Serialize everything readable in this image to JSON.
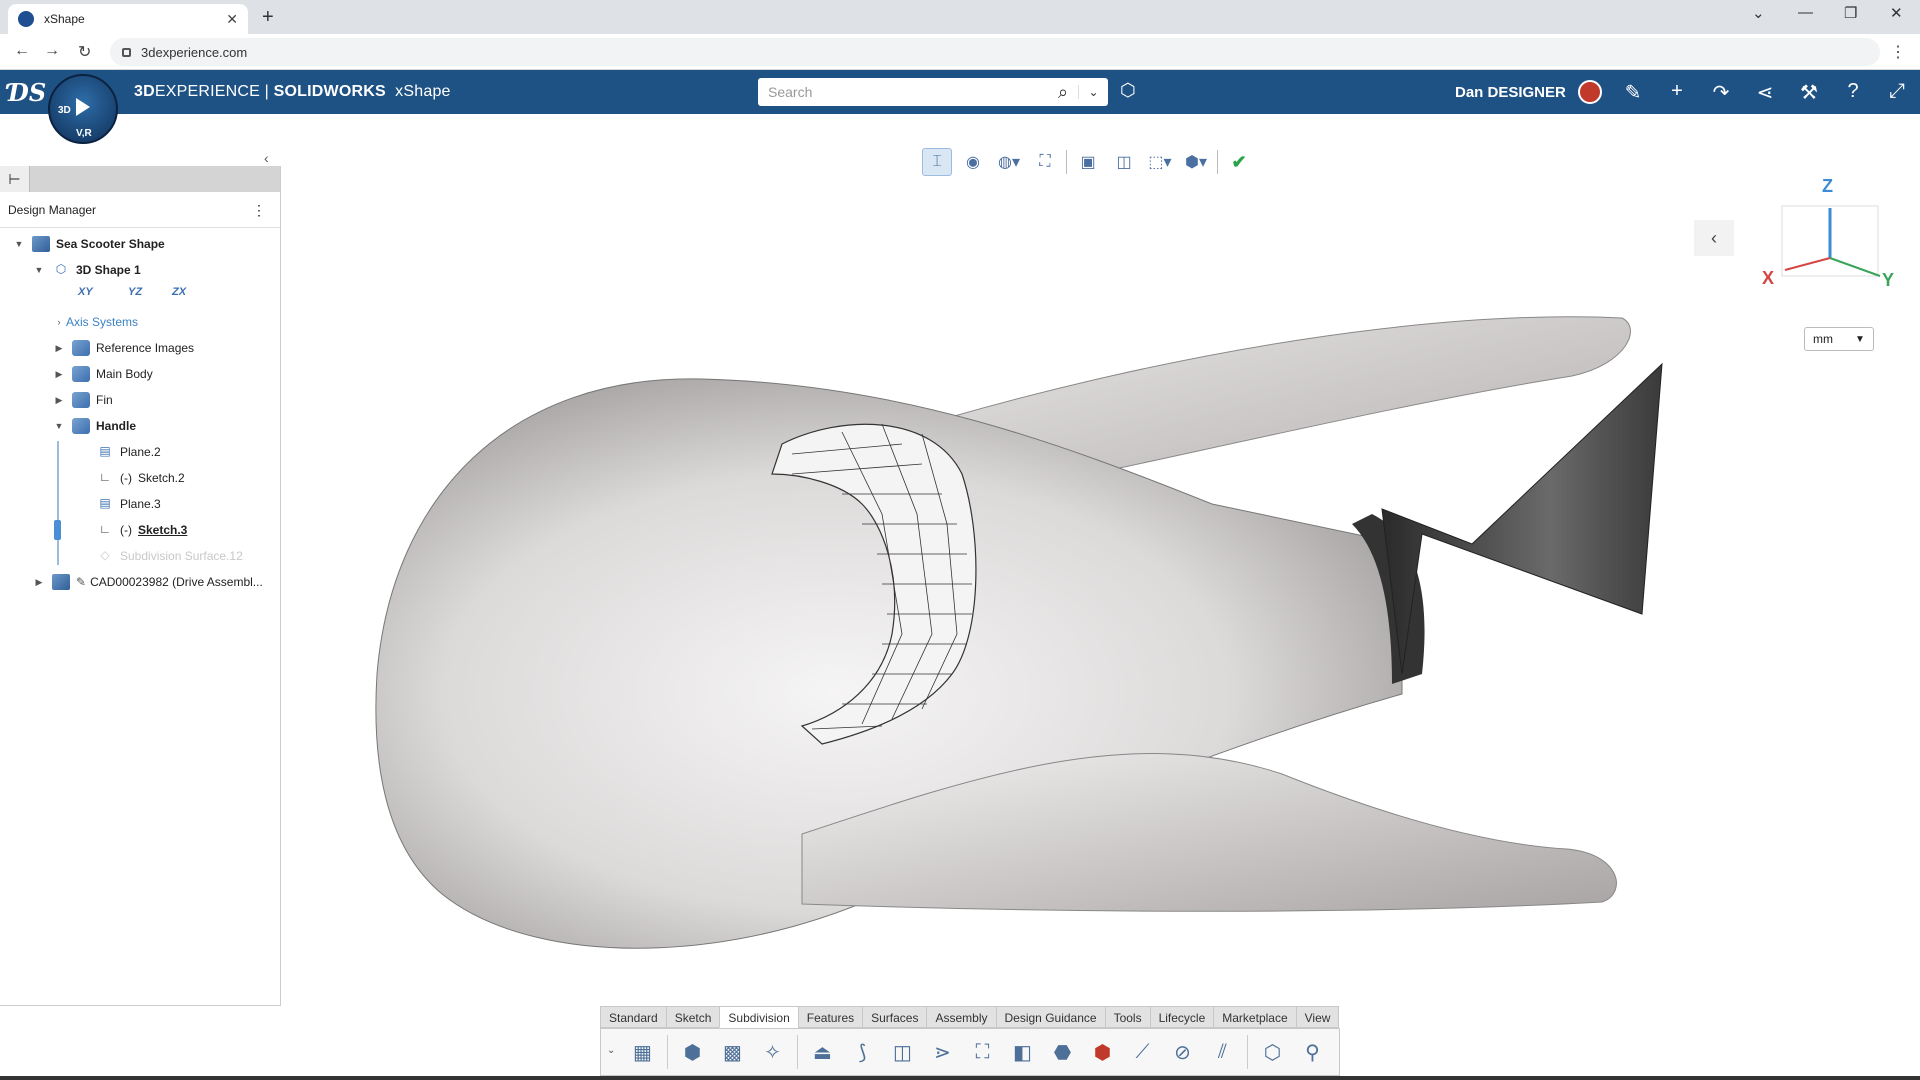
{
  "browser": {
    "tab_title": "xShape",
    "url": "3dexperience.com"
  },
  "appbar": {
    "brand_3d": "3D",
    "brand_experience": "EXPERIENCE",
    "brand_sep": " | ",
    "brand_solidworks": "SOLIDWORKS",
    "brand_app": "xShape",
    "compass_3d": "3D",
    "compass_vr": "V,R",
    "search_placeholder": "Search",
    "username": "Dan DESIGNER"
  },
  "design_manager": {
    "title": "Design Manager",
    "tree": {
      "root": "Sea Scooter Shape",
      "shape": "3D Shape 1",
      "planes": [
        "XY",
        "YZ",
        "ZX"
      ],
      "axis_systems": "Axis Systems",
      "reference_images": "Reference Images",
      "main_body": "Main Body",
      "fin": "Fin",
      "handle": "Handle",
      "plane2": "Plane.2",
      "sketch2": "Sketch.2",
      "plane3": "Plane.3",
      "sketch3": "Sketch.3",
      "subdivision": "Subdivision Surface.12",
      "cad": "CAD00023982 (Drive Assembl..."
    }
  },
  "viewport": {
    "units": "mm",
    "axes": {
      "x": "X",
      "y": "Y",
      "z": "Z"
    },
    "model_colors": {
      "body": "#e4e2e2",
      "shadow": "#9a9696",
      "nozzle": "#555555",
      "cage": "#333333"
    }
  },
  "action_bar": {
    "tabs": [
      "Standard",
      "Sketch",
      "Subdivision",
      "Features",
      "Surfaces",
      "Assembly",
      "Design Guidance",
      "Tools",
      "Lifecycle",
      "Marketplace",
      "View"
    ],
    "active_tab": "Subdivision"
  }
}
